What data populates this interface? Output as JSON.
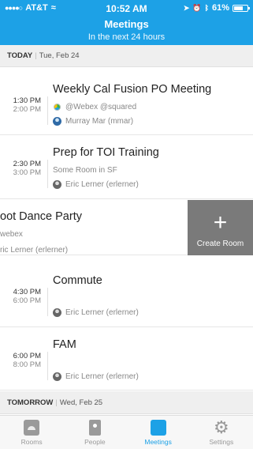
{
  "status_bar": {
    "carrier": "AT&T",
    "time": "10:52 AM",
    "battery": "61%"
  },
  "header": {
    "title": "Meetings",
    "subtitle": "In the next 24 hours"
  },
  "sections": {
    "today": {
      "label": "TODAY",
      "date": "Tue, Feb 24"
    },
    "tomorrow": {
      "label": "TOMORROW",
      "date": "Wed, Feb 25"
    }
  },
  "meetings": [
    {
      "start": "1:30 PM",
      "end": "2:00 PM",
      "title": "Weekly Cal Fusion PO Meeting",
      "location": "@Webex @squared",
      "host": "Murray Mar (mmar)"
    },
    {
      "start": "2:30 PM",
      "end": "3:00 PM",
      "title": "Prep for TOI Training",
      "location": "Some Room in SF",
      "host": "Eric Lerner (erlerner)"
    },
    {
      "title": "oot Dance Party",
      "location": "webex",
      "host": "ric Lerner (erlerner)",
      "action": "Create Room"
    },
    {
      "start": "4:30 PM",
      "end": "6:00 PM",
      "title": "Commute",
      "host": "Eric Lerner (erlerner)"
    },
    {
      "start": "6:00 PM",
      "end": "8:00 PM",
      "title": "FAM",
      "host": "Eric Lerner (erlerner)"
    }
  ],
  "tabs": [
    {
      "label": "Rooms",
      "icon": "rooms-icon"
    },
    {
      "label": "People",
      "icon": "people-icon"
    },
    {
      "label": "Meetings",
      "icon": "meetings-icon",
      "active": true
    },
    {
      "label": "Settings",
      "icon": "gear-icon"
    }
  ],
  "colors": {
    "accent": "#1da1e6",
    "swipe_action": "#7a7a7a"
  }
}
